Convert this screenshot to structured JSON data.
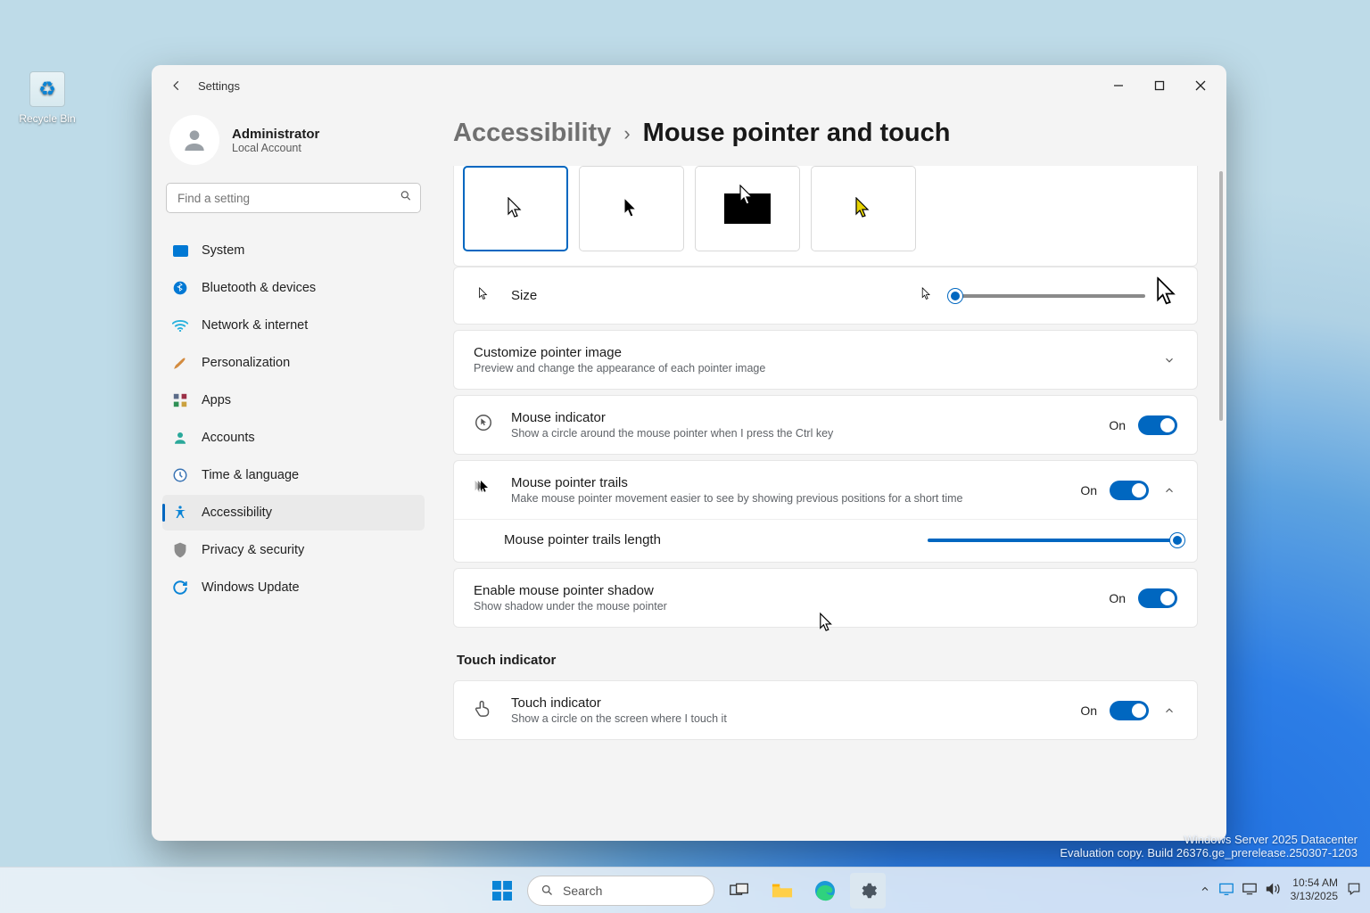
{
  "desktop": {
    "recycle_bin_label": "Recycle Bin"
  },
  "window": {
    "app_title": "Settings",
    "user_name": "Administrator",
    "user_sub": "Local Account",
    "search_placeholder": "Find a setting",
    "breadcrumb_parent": "Accessibility",
    "breadcrumb_current": "Mouse pointer and touch"
  },
  "sidebar": {
    "items": [
      {
        "label": "System"
      },
      {
        "label": "Bluetooth & devices"
      },
      {
        "label": "Network & internet"
      },
      {
        "label": "Personalization"
      },
      {
        "label": "Apps"
      },
      {
        "label": "Accounts"
      },
      {
        "label": "Time & language"
      },
      {
        "label": "Accessibility"
      },
      {
        "label": "Privacy & security"
      },
      {
        "label": "Windows Update"
      }
    ],
    "active_index": 7
  },
  "content": {
    "pointer_styles": [
      "white",
      "black",
      "inverted",
      "custom-yellow"
    ],
    "size_label": "Size",
    "customize": {
      "title": "Customize pointer image",
      "desc": "Preview and change the appearance of each pointer image"
    },
    "mouse_indicator": {
      "title": "Mouse indicator",
      "desc": "Show a circle around the mouse pointer when I press the Ctrl key",
      "state": "On"
    },
    "trails": {
      "title": "Mouse pointer trails",
      "desc": "Make mouse pointer movement easier to see by showing previous positions for a short time",
      "state": "On",
      "length_label": "Mouse pointer trails length",
      "length_percent": 100
    },
    "shadow": {
      "title": "Enable mouse pointer shadow",
      "desc": "Show shadow under the mouse pointer",
      "state": "On"
    },
    "touch_section": "Touch indicator",
    "touch": {
      "title": "Touch indicator",
      "desc": "Show a circle on the screen where I touch it",
      "state": "On"
    },
    "size_slider_percent": 3
  },
  "taskbar": {
    "search_placeholder": "Search"
  },
  "tray": {
    "time": "10:54 AM",
    "date": "3/13/2025"
  },
  "watermark": {
    "line1": "Windows Server 2025 Datacenter",
    "line2": "Evaluation copy. Build 26376.ge_prerelease.250307-1203"
  }
}
